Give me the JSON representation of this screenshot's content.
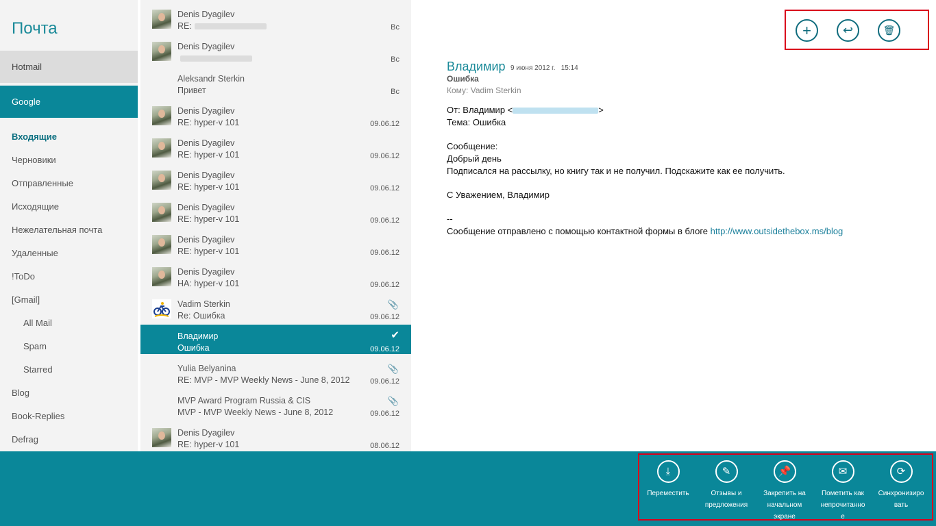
{
  "sidebar": {
    "app_title": "Почта",
    "accounts": [
      "Hotmail",
      "Google"
    ],
    "folders": [
      {
        "label": "Входящие",
        "active": true,
        "sub": false
      },
      {
        "label": "Черновики",
        "active": false,
        "sub": false
      },
      {
        "label": "Отправленные",
        "active": false,
        "sub": false
      },
      {
        "label": "Исходящие",
        "active": false,
        "sub": false
      },
      {
        "label": "Нежелательная почта",
        "active": false,
        "sub": false
      },
      {
        "label": "Удаленные",
        "active": false,
        "sub": false
      },
      {
        "label": "!ToDo",
        "active": false,
        "sub": false
      },
      {
        "label": "[Gmail]",
        "active": false,
        "sub": false
      },
      {
        "label": "All Mail",
        "active": false,
        "sub": true
      },
      {
        "label": "Spam",
        "active": false,
        "sub": true
      },
      {
        "label": "Starred",
        "active": false,
        "sub": true
      },
      {
        "label": "Blog",
        "active": false,
        "sub": false
      },
      {
        "label": "Book-Replies",
        "active": false,
        "sub": false
      },
      {
        "label": "Defrag",
        "active": false,
        "sub": false
      }
    ]
  },
  "messages": [
    {
      "sender": "Denis Dyagilev",
      "subject": "RE:",
      "blur": true,
      "date": "Вс",
      "avatar": "photo",
      "clip": false,
      "selected": false
    },
    {
      "sender": "Denis Dyagilev",
      "subject": "",
      "blur": true,
      "date": "Вс",
      "avatar": "photo",
      "clip": false,
      "selected": false
    },
    {
      "sender": "Aleksandr Sterkin",
      "subject": "Привет",
      "blur": false,
      "date": "Вс",
      "avatar": "none",
      "clip": false,
      "selected": false
    },
    {
      "sender": "Denis Dyagilev",
      "subject": "RE: hyper-v 101",
      "blur": false,
      "date": "09.06.12",
      "avatar": "photo",
      "clip": false,
      "selected": false
    },
    {
      "sender": "Denis Dyagilev",
      "subject": "RE: hyper-v 101",
      "blur": false,
      "date": "09.06.12",
      "avatar": "photo",
      "clip": false,
      "selected": false
    },
    {
      "sender": "Denis Dyagilev",
      "subject": "RE: hyper-v 101",
      "blur": false,
      "date": "09.06.12",
      "avatar": "photo",
      "clip": false,
      "selected": false
    },
    {
      "sender": "Denis Dyagilev",
      "subject": "RE: hyper-v 101",
      "blur": false,
      "date": "09.06.12",
      "avatar": "photo",
      "clip": false,
      "selected": false
    },
    {
      "sender": "Denis Dyagilev",
      "subject": "RE: hyper-v 101",
      "blur": false,
      "date": "09.06.12",
      "avatar": "photo",
      "clip": false,
      "selected": false
    },
    {
      "sender": "Denis Dyagilev",
      "subject": "HA: hyper-v 101",
      "blur": false,
      "date": "09.06.12",
      "avatar": "photo",
      "clip": false,
      "selected": false
    },
    {
      "sender": "Vadim Sterkin",
      "subject": "Re: Ошибка",
      "blur": false,
      "date": "09.06.12",
      "avatar": "bike",
      "clip": true,
      "selected": false
    },
    {
      "sender": "Владимир",
      "subject": "Ошибка",
      "blur": false,
      "date": "09.06.12",
      "avatar": "none",
      "clip": false,
      "selected": true
    },
    {
      "sender": "Yulia Belyanina",
      "subject": "RE: MVP - MVP Weekly News - June 8, 2012",
      "blur": false,
      "date": "09.06.12",
      "avatar": "none",
      "clip": true,
      "selected": false
    },
    {
      "sender": "MVP Award Program Russia & CIS",
      "subject": "MVP - MVP Weekly News - June 8, 2012",
      "blur": false,
      "date": "09.06.12",
      "avatar": "none",
      "clip": true,
      "selected": false
    },
    {
      "sender": "Denis Dyagilev",
      "subject": "RE: hyper-v 101",
      "blur": false,
      "date": "08.06.12",
      "avatar": "photo",
      "clip": false,
      "selected": false
    }
  ],
  "reader": {
    "from_name": "Владимир",
    "date": "9 июня 2012 г.",
    "time": "15:14",
    "subject": "Ошибка",
    "to": "Кому: Vadim Sterkin",
    "from_line_prefix": "От: Владимир <",
    "from_line_suffix": ">",
    "topic_line": "Тема: Ошибка",
    "msg_label": "Сообщение:",
    "greeting": "Добрый день",
    "body_text": "Подписался на рассылку, но книгу так и не получил. Подскажите как ее получить.",
    "regards": "С Уважением, Владимир",
    "sig_sep": "--",
    "footer_text": "Сообщение отправлено с помощью контактной формы в блоге ",
    "footer_link": "http://www.outsidethebox.ms/blog"
  },
  "top_commands": [
    {
      "name": "new-message",
      "glyph": "+"
    },
    {
      "name": "reply",
      "glyph": "↩"
    },
    {
      "name": "delete",
      "glyph": "🗑"
    }
  ],
  "app_bar": [
    {
      "name": "move",
      "label_lines": [
        "Переместить"
      ],
      "glyph": "⤓"
    },
    {
      "name": "feedback",
      "label_lines": [
        "Отзывы и",
        "предложения"
      ],
      "glyph": "✎"
    },
    {
      "name": "pin",
      "label_lines": [
        "Закрепить на",
        "начальном",
        "экране"
      ],
      "glyph": "📌"
    },
    {
      "name": "mark-unread",
      "label_lines": [
        "Пометить как",
        "непрочитанно",
        "е"
      ],
      "glyph": "✉"
    },
    {
      "name": "sync",
      "label_lines": [
        "Синхронизиро",
        "вать"
      ],
      "glyph": "⟳"
    }
  ],
  "colors": {
    "accent": "#0a8799",
    "highlight_box": "#d9001b"
  }
}
